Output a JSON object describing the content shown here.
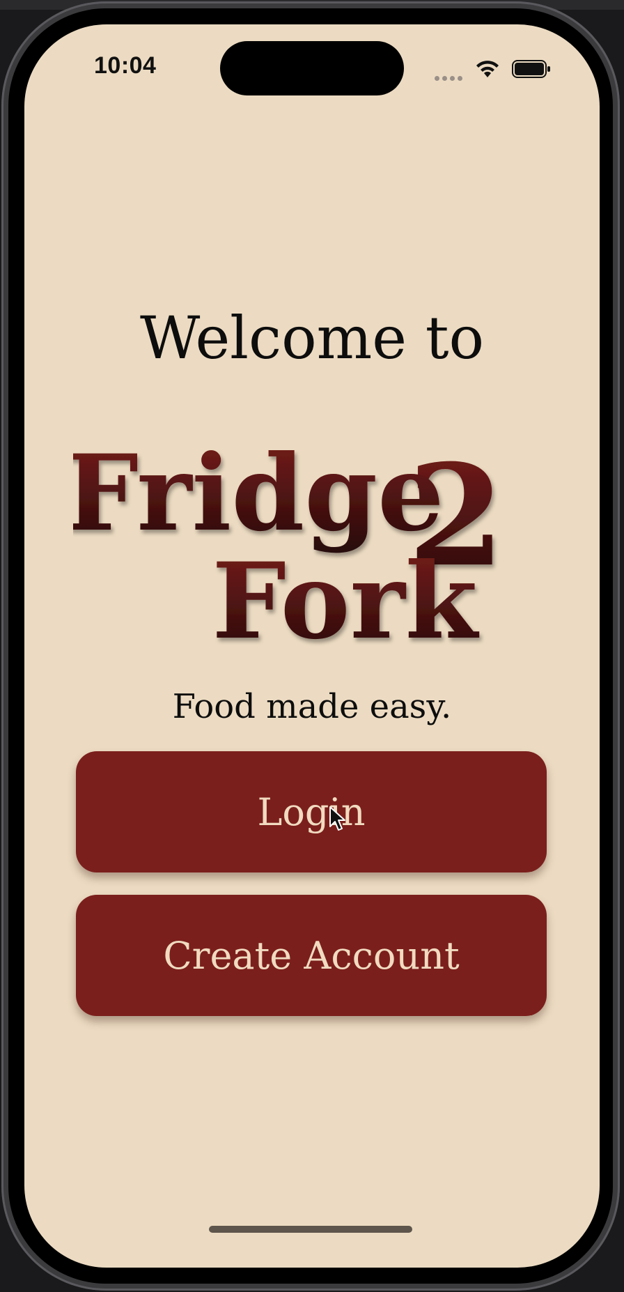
{
  "status_bar": {
    "time": "10:04",
    "icons": [
      "signal-dots-icon",
      "wifi-icon",
      "battery-icon"
    ]
  },
  "welcome": {
    "heading": "Welcome to",
    "logo_line1": "Fridge",
    "logo_numeral": "2",
    "logo_line2": "Fork",
    "tagline": "Food made easy."
  },
  "actions": {
    "login_label": "Login",
    "create_account_label": "Create Account"
  },
  "colors": {
    "background": "#ecdbc2",
    "button": "#7b1f1c",
    "button_text": "#f1dbc0",
    "logo_top": "#7a1e1c",
    "logo_bottom": "#260909"
  }
}
